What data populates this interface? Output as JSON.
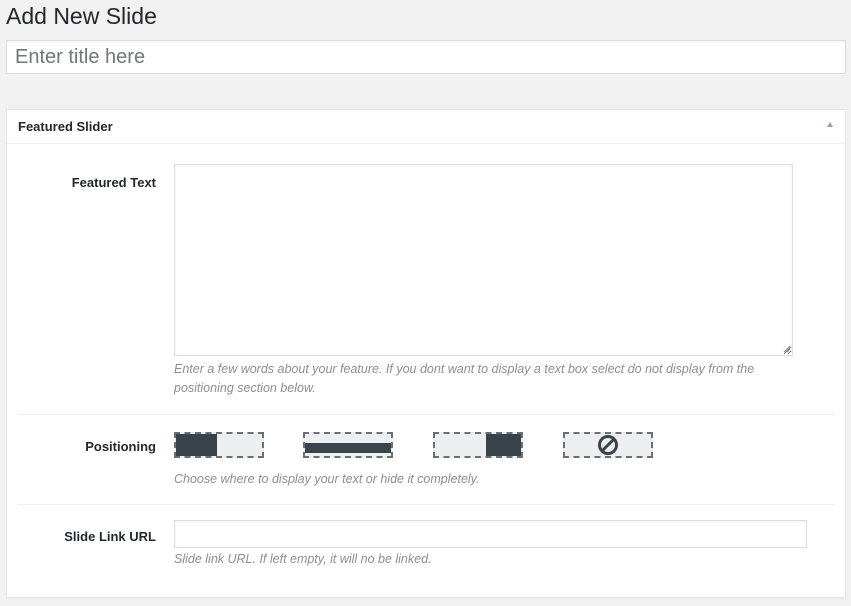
{
  "page": {
    "title": "Add New Slide"
  },
  "title_field": {
    "placeholder": "Enter title here",
    "value": ""
  },
  "metabox": {
    "title": "Featured Slider",
    "toggle_icon": "triangle-up-icon",
    "featured_text": {
      "label": "Featured Text",
      "value": "",
      "description": "Enter a few words about your feature. If you dont want to display a text box select do not display from the positioning section below."
    },
    "positioning": {
      "label": "Positioning",
      "options": [
        {
          "name": "left",
          "icon": "position-left-icon"
        },
        {
          "name": "bottom",
          "icon": "position-bottom-icon"
        },
        {
          "name": "right",
          "icon": "position-right-icon"
        },
        {
          "name": "hide",
          "icon": "prohibited-icon"
        }
      ],
      "description": "Choose where to display your text or hide it completely."
    },
    "slide_link": {
      "label": "Slide Link URL",
      "value": "",
      "description": "Slide link URL. If left empty, it will no be linked."
    }
  },
  "colors": {
    "background": "#f1f1f1",
    "panel": "#ffffff",
    "option_fill": "#39434a",
    "option_bg": "#eceeef",
    "description_text": "#8a8f94"
  }
}
